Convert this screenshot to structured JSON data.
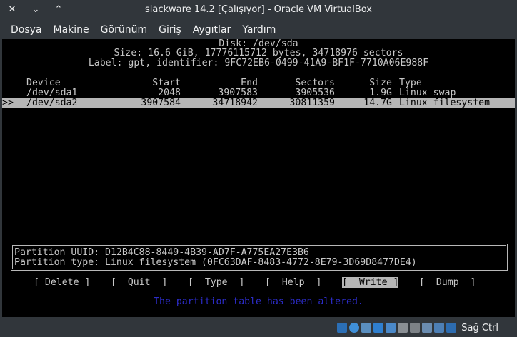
{
  "window": {
    "title": "slackware 14.2 [Çalışıyor] - Oracle VM VirtualBox",
    "close_glyph": "✕",
    "minimize_glyph": "⌄",
    "maximize_glyph": "⌃"
  },
  "menu": [
    "Dosya",
    "Makine",
    "Görünüm",
    "Giriş",
    "Aygıtlar",
    "Yardım"
  ],
  "cfdisk": {
    "disk_line": "Disk: /dev/sda",
    "size_line": "Size: 16.6 GiB, 17776115712 bytes, 34718976 sectors",
    "label_line": "Label: gpt, identifier: 9FC72EB6-0499-41A9-BF1F-7710A06E988F",
    "columns": {
      "device": "Device",
      "start": "Start",
      "end": "End",
      "sectors": "Sectors",
      "size": "Size",
      "type": "Type"
    },
    "partitions": [
      {
        "marker": "",
        "device": "/dev/sda1",
        "start": "2048",
        "end": "3907583",
        "sectors": "3905536",
        "size": "1.9G",
        "type": "Linux swap"
      },
      {
        "marker": ">>",
        "device": "/dev/sda2",
        "start": "3907584",
        "end": "34718942",
        "sectors": "30811359",
        "size": "14.7G",
        "type": "Linux filesystem"
      }
    ],
    "info_uuid": "Partition UUID: D12B4C88-8449-4B39-AD7F-A775EA27E3B6",
    "info_type": "Partition type: Linux filesystem (0FC63DAF-8483-4772-8E79-3D69D8477DE4)",
    "buttons": [
      {
        "label": " Delete ",
        "active": false
      },
      {
        "label": "  Quit  ",
        "active": false
      },
      {
        "label": "  Type  ",
        "active": false
      },
      {
        "label": "  Help  ",
        "active": false
      },
      {
        "label": "  Write ",
        "active": true
      },
      {
        "label": "  Dump  ",
        "active": false
      }
    ],
    "status_message": "The partition table has been altered."
  },
  "statusbar": {
    "host_key": "Sağ Ctrl",
    "icons": [
      "hdd-icon",
      "optical-disc-icon",
      "audio-icon",
      "network-icon",
      "usb-icon",
      "shared-folder-icon",
      "display-icon",
      "video-capture-icon",
      "cpu-icon",
      "mouse-integration-icon"
    ]
  },
  "colors": {
    "chrome": "#31363b",
    "screen_bg": "#000000",
    "screen_fg": "#c8c8c8",
    "selection_bg": "#b6b6b6",
    "status_blue": "#2c2cc8"
  }
}
